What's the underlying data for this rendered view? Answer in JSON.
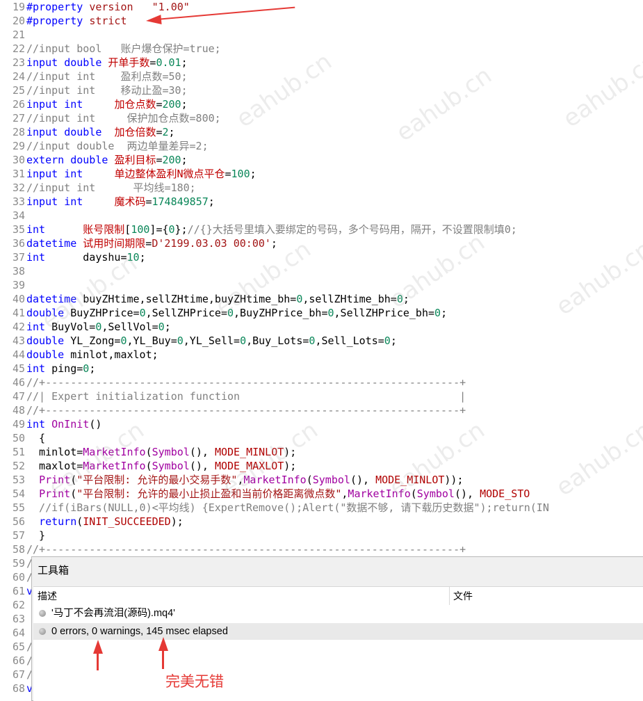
{
  "editor": {
    "lines": [
      {
        "n": "19",
        "tokens": [
          [
            "blue",
            "#property"
          ],
          [
            "txt",
            " "
          ],
          [
            "red",
            "version"
          ],
          [
            "txt",
            "   "
          ],
          [
            "str",
            "\"1.00\""
          ]
        ]
      },
      {
        "n": "20",
        "tokens": [
          [
            "blue",
            "#property"
          ],
          [
            "txt",
            " "
          ],
          [
            "red",
            "strict"
          ]
        ]
      },
      {
        "n": "21",
        "tokens": []
      },
      {
        "n": "22",
        "tokens": [
          [
            "cmt",
            "//input bool   "
          ],
          [
            "cmtcn",
            "账户爆仓保护"
          ],
          [
            "cmt",
            "=true;"
          ]
        ]
      },
      {
        "n": "23",
        "tokens": [
          [
            "blue",
            "input"
          ],
          [
            "txt",
            " "
          ],
          [
            "blue",
            "double"
          ],
          [
            "txt",
            " "
          ],
          [
            "cn",
            "开单手数"
          ],
          [
            "txt",
            "="
          ],
          [
            "num",
            "0.01"
          ],
          [
            "txt",
            ";"
          ]
        ]
      },
      {
        "n": "24",
        "tokens": [
          [
            "cmt",
            "//input int    "
          ],
          [
            "cmtcn",
            "盈利点数"
          ],
          [
            "cmt",
            "=50;"
          ]
        ]
      },
      {
        "n": "25",
        "tokens": [
          [
            "cmt",
            "//input int    "
          ],
          [
            "cmtcn",
            "移动止盈"
          ],
          [
            "cmt",
            "=30;"
          ]
        ]
      },
      {
        "n": "26",
        "tokens": [
          [
            "blue",
            "input"
          ],
          [
            "txt",
            " "
          ],
          [
            "blue",
            "int"
          ],
          [
            "txt",
            "     "
          ],
          [
            "cn",
            "加仓点数"
          ],
          [
            "txt",
            "="
          ],
          [
            "num",
            "200"
          ],
          [
            "txt",
            ";"
          ]
        ]
      },
      {
        "n": "27",
        "tokens": [
          [
            "cmt",
            "//input int     "
          ],
          [
            "cmtcn",
            "保护加仓点数"
          ],
          [
            "cmt",
            "=800;"
          ]
        ]
      },
      {
        "n": "28",
        "tokens": [
          [
            "blue",
            "input"
          ],
          [
            "txt",
            " "
          ],
          [
            "blue",
            "double"
          ],
          [
            "txt",
            "  "
          ],
          [
            "cn",
            "加仓倍数"
          ],
          [
            "txt",
            "="
          ],
          [
            "num",
            "2"
          ],
          [
            "txt",
            ";"
          ]
        ]
      },
      {
        "n": "29",
        "tokens": [
          [
            "cmt",
            "//input double  "
          ],
          [
            "cmtcn",
            "两边单量差异"
          ],
          [
            "cmt",
            "=2;"
          ]
        ]
      },
      {
        "n": "30",
        "tokens": [
          [
            "blue",
            "extern"
          ],
          [
            "txt",
            " "
          ],
          [
            "blue",
            "double"
          ],
          [
            "txt",
            " "
          ],
          [
            "cn",
            "盈利目标"
          ],
          [
            "txt",
            "="
          ],
          [
            "num",
            "200"
          ],
          [
            "txt",
            ";"
          ]
        ]
      },
      {
        "n": "31",
        "tokens": [
          [
            "blue",
            "input"
          ],
          [
            "txt",
            " "
          ],
          [
            "blue",
            "int"
          ],
          [
            "txt",
            "     "
          ],
          [
            "cn",
            "单边整体盈利N微点平仓"
          ],
          [
            "txt",
            "="
          ],
          [
            "num",
            "100"
          ],
          [
            "txt",
            ";"
          ]
        ]
      },
      {
        "n": "32",
        "tokens": [
          [
            "cmt",
            "//input int      "
          ],
          [
            "cmtcn",
            "平均线"
          ],
          [
            "cmt",
            "=180;"
          ]
        ]
      },
      {
        "n": "33",
        "tokens": [
          [
            "blue",
            "input"
          ],
          [
            "txt",
            " "
          ],
          [
            "blue",
            "int"
          ],
          [
            "txt",
            "     "
          ],
          [
            "cn",
            "魔术码"
          ],
          [
            "txt",
            "="
          ],
          [
            "num",
            "174849857"
          ],
          [
            "txt",
            ";"
          ]
        ]
      },
      {
        "n": "34",
        "tokens": []
      },
      {
        "n": "35",
        "tokens": [
          [
            "blue",
            "int"
          ],
          [
            "txt",
            "      "
          ],
          [
            "cn",
            "账号限制"
          ],
          [
            "txt",
            "["
          ],
          [
            "num",
            "100"
          ],
          [
            "txt",
            "]={"
          ],
          [
            "num",
            "0"
          ],
          [
            "txt",
            "};"
          ],
          [
            "cmt",
            "//{}"
          ],
          [
            "cmtcn",
            "大括号里填入要绑定的号码，多个号码用，隔开，不设置限制填0;"
          ]
        ]
      },
      {
        "n": "36",
        "tokens": [
          [
            "blue",
            "datetime"
          ],
          [
            "txt",
            " "
          ],
          [
            "cn",
            "试用时间期限"
          ],
          [
            "txt",
            "="
          ],
          [
            "str",
            "D'2199.03.03 00:00'"
          ],
          [
            "txt",
            ";"
          ]
        ]
      },
      {
        "n": "37",
        "tokens": [
          [
            "blue",
            "int"
          ],
          [
            "txt",
            "      dayshu="
          ],
          [
            "num",
            "10"
          ],
          [
            "txt",
            ";"
          ]
        ]
      },
      {
        "n": "38",
        "tokens": []
      },
      {
        "n": "39",
        "tokens": []
      },
      {
        "n": "40",
        "tokens": [
          [
            "blue",
            "datetime"
          ],
          [
            "txt",
            " buyZHtime,sellZHtime,buyZHtime_bh="
          ],
          [
            "num",
            "0"
          ],
          [
            "txt",
            ",sellZHtime_bh="
          ],
          [
            "num",
            "0"
          ],
          [
            "txt",
            ";"
          ]
        ]
      },
      {
        "n": "41",
        "tokens": [
          [
            "blue",
            "double"
          ],
          [
            "txt",
            " BuyZHPrice="
          ],
          [
            "num",
            "0"
          ],
          [
            "txt",
            ",SellZHPrice="
          ],
          [
            "num",
            "0"
          ],
          [
            "txt",
            ",BuyZHPrice_bh="
          ],
          [
            "num",
            "0"
          ],
          [
            "txt",
            ",SellZHPrice_bh="
          ],
          [
            "num",
            "0"
          ],
          [
            "txt",
            ";"
          ]
        ]
      },
      {
        "n": "42",
        "tokens": [
          [
            "blue",
            "int"
          ],
          [
            "txt",
            " BuyVol="
          ],
          [
            "num",
            "0"
          ],
          [
            "txt",
            ",SellVol="
          ],
          [
            "num",
            "0"
          ],
          [
            "txt",
            ";"
          ]
        ]
      },
      {
        "n": "43",
        "tokens": [
          [
            "blue",
            "double"
          ],
          [
            "txt",
            " YL_Zong="
          ],
          [
            "num",
            "0"
          ],
          [
            "txt",
            ",YL_Buy="
          ],
          [
            "num",
            "0"
          ],
          [
            "txt",
            ",YL_Sell="
          ],
          [
            "num",
            "0"
          ],
          [
            "txt",
            ",Buy_Lots="
          ],
          [
            "num",
            "0"
          ],
          [
            "txt",
            ",Sell_Lots="
          ],
          [
            "num",
            "0"
          ],
          [
            "txt",
            ";"
          ]
        ]
      },
      {
        "n": "44",
        "tokens": [
          [
            "blue",
            "double"
          ],
          [
            "txt",
            " minlot,maxlot;"
          ]
        ]
      },
      {
        "n": "45",
        "tokens": [
          [
            "blue",
            "int"
          ],
          [
            "txt",
            " ping="
          ],
          [
            "num",
            "0"
          ],
          [
            "txt",
            ";"
          ]
        ]
      },
      {
        "n": "46",
        "tokens": [
          [
            "cmt",
            "//+------------------------------------------------------------------+"
          ]
        ]
      },
      {
        "n": "47",
        "tokens": [
          [
            "cmt",
            "//| Expert initialization function                                   |"
          ]
        ]
      },
      {
        "n": "48",
        "tokens": [
          [
            "cmt",
            "//+------------------------------------------------------------------+"
          ]
        ]
      },
      {
        "n": "49",
        "tokens": [
          [
            "blue",
            "int"
          ],
          [
            "txt",
            " "
          ],
          [
            "fn",
            "OnInit"
          ],
          [
            "txt",
            "()"
          ]
        ]
      },
      {
        "n": "50",
        "tokens": [
          [
            "txt",
            "  {"
          ]
        ]
      },
      {
        "n": "51",
        "tokens": [
          [
            "txt",
            "  minlot="
          ],
          [
            "fn",
            "MarketInfo"
          ],
          [
            "txt",
            "("
          ],
          [
            "fn",
            "Symbol"
          ],
          [
            "txt",
            "(), "
          ],
          [
            "const",
            "MODE_MINLOT"
          ],
          [
            "txt",
            ");"
          ]
        ]
      },
      {
        "n": "52",
        "tokens": [
          [
            "txt",
            "  maxlot="
          ],
          [
            "fn",
            "MarketInfo"
          ],
          [
            "txt",
            "("
          ],
          [
            "fn",
            "Symbol"
          ],
          [
            "txt",
            "(), "
          ],
          [
            "const",
            "MODE_MAXLOT"
          ],
          [
            "txt",
            ");"
          ]
        ]
      },
      {
        "n": "53",
        "tokens": [
          [
            "txt",
            "  "
          ],
          [
            "fn",
            "Print"
          ],
          [
            "txt",
            "("
          ],
          [
            "str",
            "\"平台限制: 允许的最小交易手数\""
          ],
          [
            "txt",
            ","
          ],
          [
            "fn",
            "MarketInfo"
          ],
          [
            "txt",
            "("
          ],
          [
            "fn",
            "Symbol"
          ],
          [
            "txt",
            "(), "
          ],
          [
            "const",
            "MODE_MINLOT"
          ],
          [
            "txt",
            "));"
          ]
        ]
      },
      {
        "n": "54",
        "tokens": [
          [
            "txt",
            "  "
          ],
          [
            "fn",
            "Print"
          ],
          [
            "txt",
            "("
          ],
          [
            "str",
            "\"平台限制: 允许的最小止损止盈和当前价格距离微点数\""
          ],
          [
            "txt",
            ","
          ],
          [
            "fn",
            "MarketInfo"
          ],
          [
            "txt",
            "("
          ],
          [
            "fn",
            "Symbol"
          ],
          [
            "txt",
            "(), "
          ],
          [
            "const",
            "MODE_STO"
          ]
        ]
      },
      {
        "n": "55",
        "tokens": [
          [
            "cmt",
            "  //if(iBars(NULL,0)<平均线) {ExpertRemove();Alert(\"数据不够, 请下载历史数据\");return(IN"
          ]
        ]
      },
      {
        "n": "56",
        "tokens": [
          [
            "txt",
            "  "
          ],
          [
            "blue",
            "return"
          ],
          [
            "txt",
            "("
          ],
          [
            "const",
            "INIT_SUCCEEDED"
          ],
          [
            "txt",
            ");"
          ]
        ]
      },
      {
        "n": "57",
        "tokens": [
          [
            "txt",
            "  }"
          ]
        ]
      },
      {
        "n": "58",
        "tokens": [
          [
            "cmt",
            "//+------------------------------------------------------------------+"
          ]
        ]
      },
      {
        "n": "59",
        "tokens": [
          [
            "cmt",
            "/"
          ]
        ]
      },
      {
        "n": "60",
        "tokens": [
          [
            "cmt",
            "/"
          ]
        ]
      },
      {
        "n": "61",
        "tokens": [
          [
            "blue",
            "v"
          ]
        ]
      },
      {
        "n": "62",
        "tokens": []
      },
      {
        "n": "63",
        "tokens": []
      },
      {
        "n": "64",
        "tokens": []
      },
      {
        "n": "65",
        "tokens": [
          [
            "cmt",
            "/"
          ]
        ]
      },
      {
        "n": "66",
        "tokens": [
          [
            "cmt",
            "/"
          ]
        ]
      },
      {
        "n": "67",
        "tokens": [
          [
            "cmt",
            "/"
          ]
        ]
      },
      {
        "n": "68",
        "tokens": [
          [
            "blue",
            "v"
          ]
        ]
      }
    ]
  },
  "toolbox": {
    "title": "工具箱",
    "columns": [
      "描述",
      "文件"
    ],
    "rows": [
      {
        "text": "'马丁不会再流泪(源码).mq4'",
        "selected": false
      },
      {
        "text": "0 errors, 0 warnings, 145 msec elapsed",
        "selected": true
      }
    ]
  },
  "annotation": {
    "label": "完美无错",
    "color": "#e53935"
  },
  "watermark": {
    "text": "eahub.cn"
  },
  "colors": {
    "keyword": "#0000ff",
    "comment": "#808080",
    "number": "#098658",
    "function": "#a000a0",
    "constant": "#b00000",
    "identifier_cn": "#c00000"
  }
}
